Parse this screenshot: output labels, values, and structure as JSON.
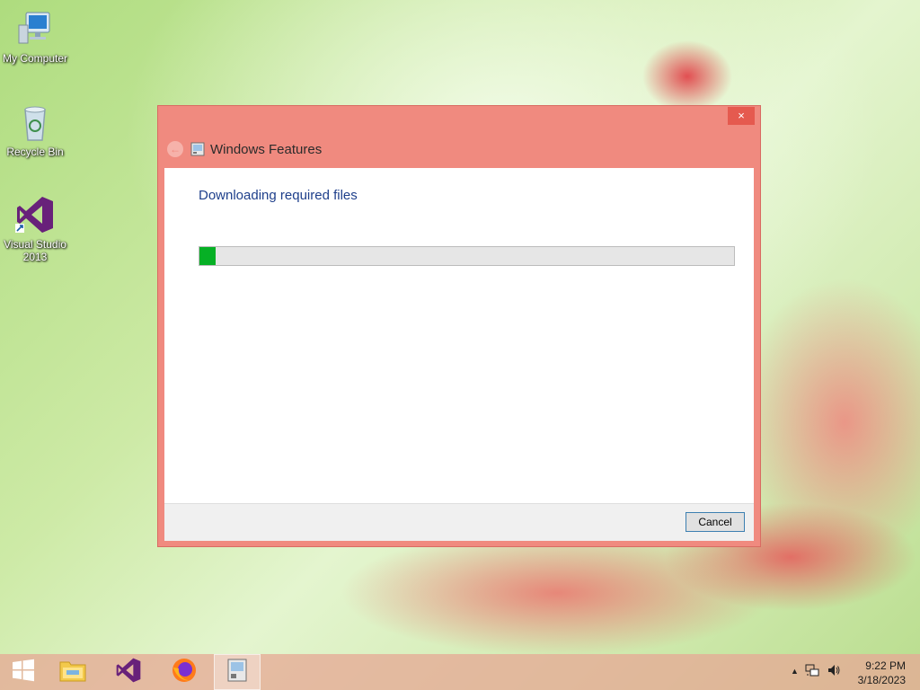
{
  "desktop": {
    "icons": [
      {
        "label": "My Computer",
        "icon": "computer-icon"
      },
      {
        "label": "Recycle Bin",
        "icon": "recycle-bin-icon"
      },
      {
        "label": "Visual Studio 2013",
        "icon": "visual-studio-icon"
      }
    ]
  },
  "dialog": {
    "title": "Windows Features",
    "heading": "Downloading required files",
    "progress": 0.03,
    "close_label": "×",
    "back_label": "←",
    "cancel_label": "Cancel"
  },
  "taskbar": {
    "items": [
      {
        "name": "start",
        "icon": "windows-logo-icon"
      },
      {
        "name": "file-explorer",
        "icon": "folder-icon"
      },
      {
        "name": "visual-studio",
        "icon": "visual-studio-icon"
      },
      {
        "name": "firefox",
        "icon": "firefox-icon"
      },
      {
        "name": "windows-features",
        "icon": "windows-features-icon",
        "active": true
      }
    ],
    "tray": {
      "show_hidden_label": "▲",
      "time": "9:22 PM",
      "date": "3/18/2023"
    }
  },
  "colors": {
    "dialog_frame": "#f08a7f",
    "close_button": "#e55a4f",
    "progress_fill": "#06b025",
    "heading_text": "#1e3f8b"
  }
}
